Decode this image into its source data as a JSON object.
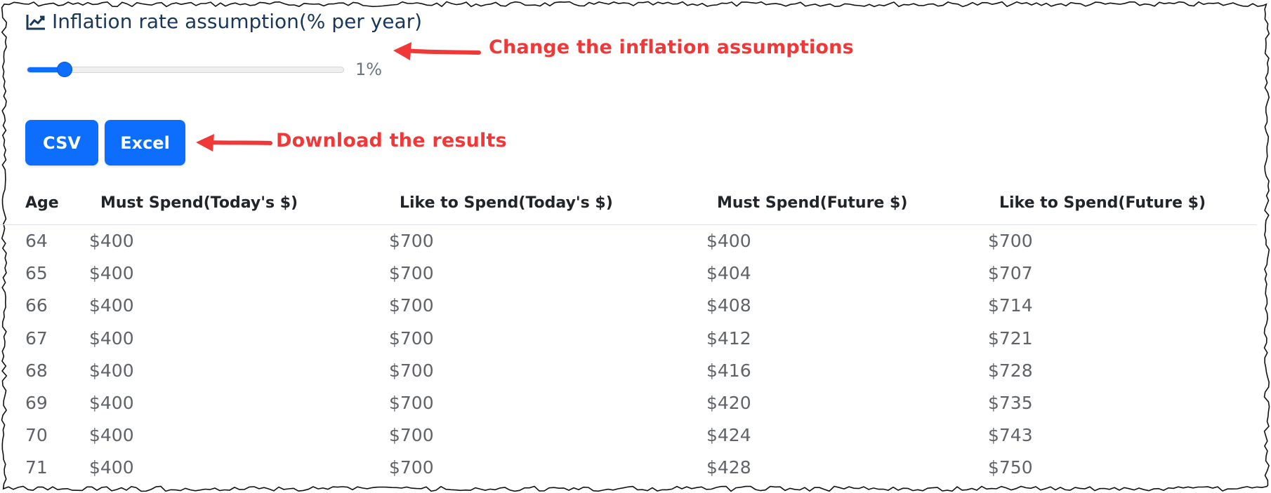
{
  "section": {
    "title": "Inflation rate assumption(% per year)",
    "icon": "chart-line-icon"
  },
  "inflation_slider": {
    "value": 1,
    "min": 0,
    "max": 10,
    "value_label": "1%"
  },
  "download": {
    "csv_label": "CSV",
    "excel_label": "Excel"
  },
  "annotations": {
    "inflation": "Change the inflation assumptions",
    "download": "Download the results"
  },
  "colors": {
    "accent": "#0d6efd",
    "annotation": "#f03838",
    "title": "#17385a"
  },
  "table": {
    "headers": [
      "Age",
      "Must Spend(Today's $)",
      "Like to Spend(Today's $)",
      "Must Spend(Future $)",
      "Like to Spend(Future $)"
    ],
    "rows": [
      [
        "64",
        "$400",
        "$700",
        "$400",
        "$700"
      ],
      [
        "65",
        "$400",
        "$700",
        "$404",
        "$707"
      ],
      [
        "66",
        "$400",
        "$700",
        "$408",
        "$714"
      ],
      [
        "67",
        "$400",
        "$700",
        "$412",
        "$721"
      ],
      [
        "68",
        "$400",
        "$700",
        "$416",
        "$728"
      ],
      [
        "69",
        "$400",
        "$700",
        "$420",
        "$735"
      ],
      [
        "70",
        "$400",
        "$700",
        "$424",
        "$743"
      ],
      [
        "71",
        "$400",
        "$700",
        "$428",
        "$750"
      ]
    ]
  }
}
